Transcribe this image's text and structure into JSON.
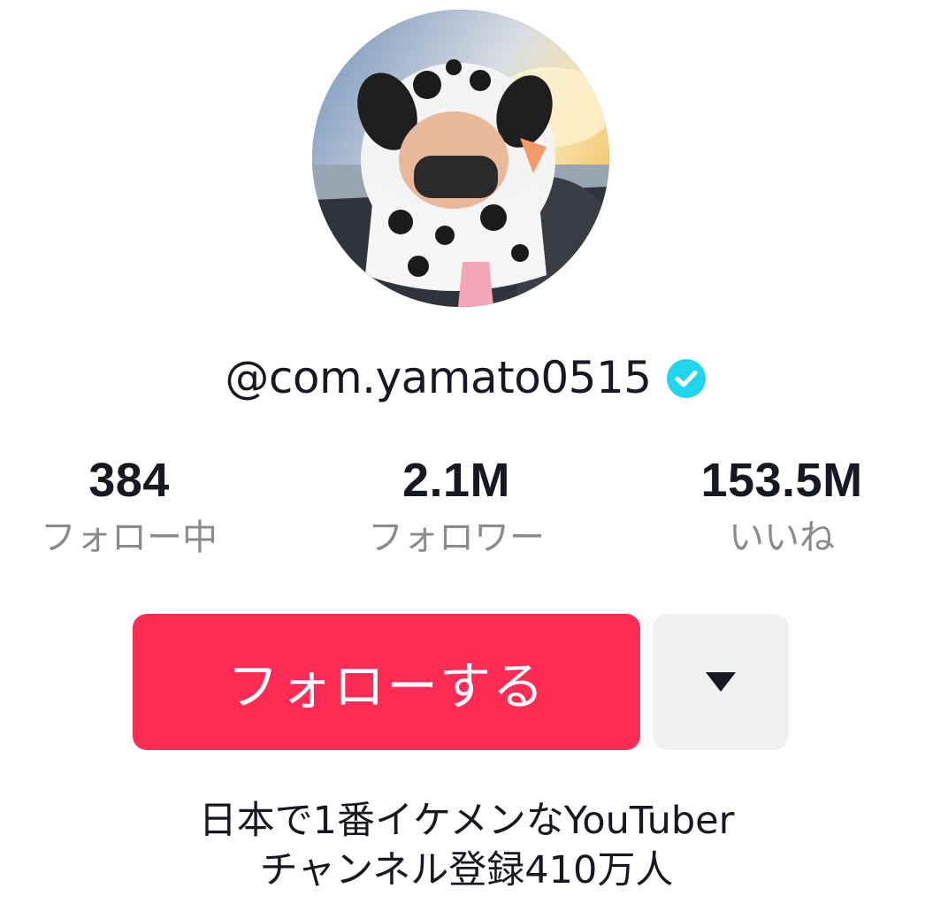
{
  "profile": {
    "username": "@com.yamato0515",
    "verified": true,
    "verified_icon": "verified-check-icon",
    "avatar_icon": "profile-avatar-photo"
  },
  "stats": {
    "following": {
      "value": "384",
      "label": "フォロー中"
    },
    "followers": {
      "value": "2.1M",
      "label": "フォロワー"
    },
    "likes": {
      "value": "153.5M",
      "label": "いいね"
    }
  },
  "actions": {
    "follow_label": "フォローする",
    "more_icon": "caret-down-icon"
  },
  "bio": {
    "lines": [
      "日本で1番イケメンなYouTuber",
      "チャンネル登録410万人"
    ]
  },
  "colors": {
    "accent": "#fe2c55",
    "verified": "#20d5ec",
    "text": "#161823",
    "muted": "#8a8b91",
    "secondary_button": "#f1f1f2"
  }
}
